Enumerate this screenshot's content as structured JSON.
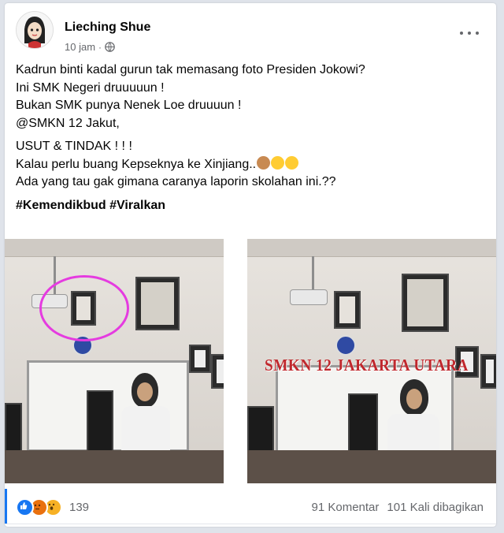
{
  "post": {
    "author": "Lieching Shue",
    "time": "10 jam",
    "separator": "·",
    "text_lines": [
      "Kadrun binti kadal gurun tak memasang foto Presiden Jokowi?",
      "Ini SMK Negeri druuuuun !",
      "Bukan SMK punya Nenek Loe druuuun !",
      "@SMKN 12 Jakut,"
    ],
    "text_lines_2": [
      "USUT & TINDAK ! ! !",
      "Kalau perlu buang Kepseknya ke Xinjiang..",
      "Ada yang tau gak gimana caranya laporin skolahan ini.??"
    ],
    "hashtags": [
      "#Kemendikbud",
      "#Viralkan"
    ],
    "image_overlay_text": "SMKN 12 JAKARTA UTARA"
  },
  "footer": {
    "reaction_count": "139",
    "comments": "91 Komentar",
    "shares": "101 Kali dibagikan"
  },
  "icons": {
    "globe": "globe-icon",
    "more": "more-options-icon",
    "like": "like-reaction-icon",
    "angry": "angry-reaction-icon",
    "wow": "wow-reaction-icon"
  },
  "colors": {
    "text": "#050505",
    "secondary": "#65676b",
    "like_blue": "#1877f2",
    "highlight_circle": "#e53be0",
    "overlay_red": "#c0282d"
  }
}
